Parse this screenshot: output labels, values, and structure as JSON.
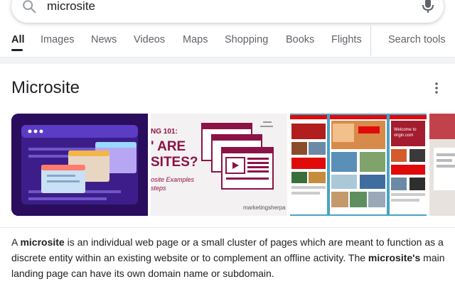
{
  "search": {
    "query": "microsite",
    "icon": "search-icon",
    "mic_icon": "mic-icon"
  },
  "tabs": [
    {
      "label": "All",
      "active": true
    },
    {
      "label": "Images",
      "active": false
    },
    {
      "label": "News",
      "active": false
    },
    {
      "label": "Videos",
      "active": false
    },
    {
      "label": "Maps",
      "active": false
    },
    {
      "label": "Shopping",
      "active": false
    },
    {
      "label": "Books",
      "active": false
    },
    {
      "label": "Flights",
      "active": false
    }
  ],
  "search_tools_label": "Search tools",
  "knowledge_panel": {
    "title": "Microsite",
    "more_icon": "more-vertical-icon",
    "images": [
      {
        "name": "microsite-illustration",
        "colors": {
          "bg": "#2a0d5c",
          "accent": "#5b3cc4"
        }
      },
      {
        "name": "marketingsherpa-thumbnail",
        "lines": [
          "NG 101:",
          "' ARE",
          "SITES?"
        ],
        "caption": [
          "osite Examples",
          "steps"
        ],
        "brand": "marketingsherpa"
      },
      {
        "name": "virgin-microsite-screenshot",
        "brand": "virgin.com",
        "overlay": "Welcome to virgin.com"
      },
      {
        "name": "partial-thumbnail"
      }
    ],
    "description": {
      "p1_a": "A ",
      "p1_bold1": "microsite",
      "p1_b": " is an individual web page or a small cluster of pages which are meant to function as a discrete entity within an existing website or to complement an offline activity. The ",
      "p1_bold2": "microsite's",
      "p1_c": " main landing page can have its own domain name or subdomain."
    }
  },
  "colors": {
    "accent": "#202124",
    "muted": "#5f6368",
    "divider": "#dadce0",
    "band": "#f1f3f4",
    "brand_red": "#8c1346",
    "virgin_red": "#e10a0a"
  }
}
